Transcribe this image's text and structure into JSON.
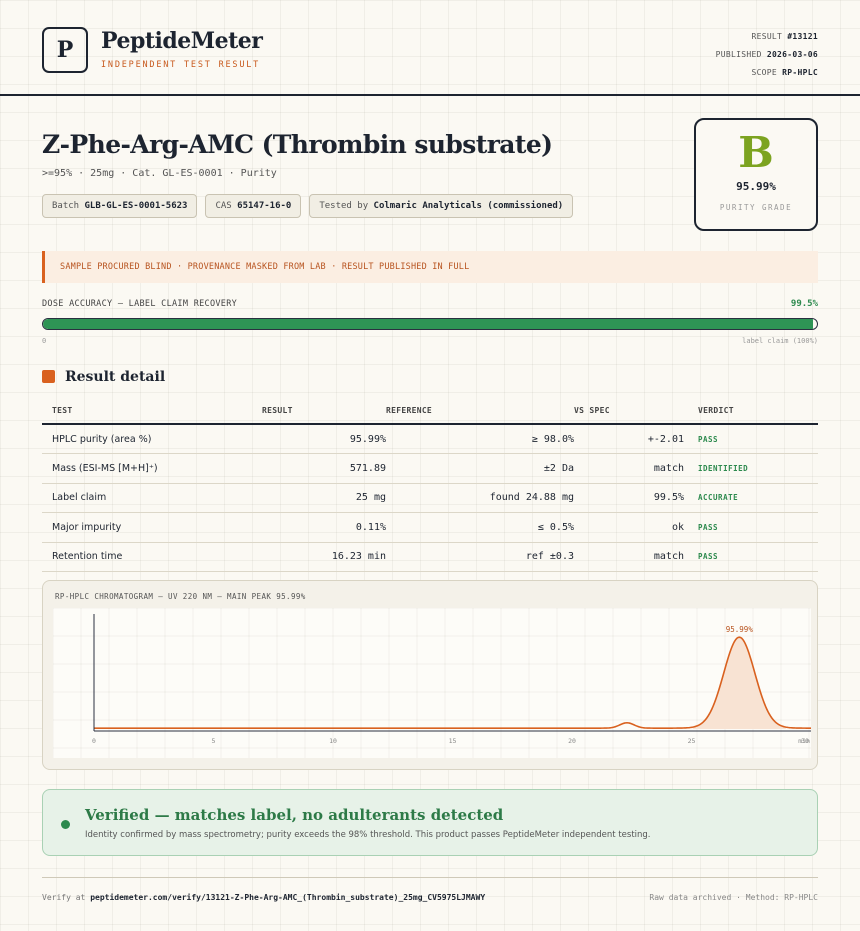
{
  "header": {
    "logo_letter": "P",
    "brand": "PeptideMeter",
    "brand_sub": "INDEPENDENT TEST RESULT",
    "result_label": "RESULT",
    "result_value": "#13121",
    "published_label": "PUBLISHED",
    "published_value": "2026-03-06",
    "scope_label": "SCOPE",
    "scope_value": "RP-HPLC"
  },
  "product": {
    "title": "Z-Phe-Arg-AMC (Thrombin substrate)",
    "subtitle": ">=95% · 25mg · Cat. GL-ES-0001 · Purity",
    "batch_label": "Batch",
    "batch_value": "GLB-GL-ES-0001-5623",
    "cas_label": "CAS",
    "cas_value": "65147-16-0",
    "tested_label": "Tested by",
    "tested_value": "Colmaric Analyticals (commissioned)"
  },
  "grade": {
    "letter": "B",
    "value": "95.99%",
    "label": "PURITY GRADE",
    "color": "#7ca320"
  },
  "notice": "SAMPLE PROCURED BLIND · PROVENANCE MASKED FROM LAB · RESULT PUBLISHED IN FULL",
  "dose": {
    "label": "DOSE ACCURACY — LABEL CLAIM RECOVERY",
    "value_text": "99.5%",
    "fraction": 0.995,
    "min_label": "0",
    "max_label": "label claim (100%)"
  },
  "section_title": "Result detail",
  "table": {
    "headers": [
      "TEST",
      "RESULT",
      "REFERENCE",
      "VS SPEC",
      "VERDICT"
    ],
    "rows": [
      {
        "test": "HPLC purity (area %)",
        "result": "95.99%",
        "reference": "≥ 98.0%",
        "vs_spec": "+-2.01",
        "verdict": "PASS"
      },
      {
        "test": "Mass (ESI-MS [M+H]⁺)",
        "result": "571.89",
        "reference": "±2 Da",
        "vs_spec": "match",
        "verdict": "IDENTIFIED"
      },
      {
        "test": "Label claim",
        "result": "25 mg",
        "reference": "found 24.88 mg",
        "vs_spec": "99.5%",
        "verdict": "ACCURATE"
      },
      {
        "test": "Major impurity",
        "result": "0.11%",
        "reference": "≤ 0.5%",
        "vs_spec": "ok",
        "verdict": "PASS"
      },
      {
        "test": "Retention time",
        "result": "16.23 min",
        "reference": "ref ±0.3",
        "vs_spec": "match",
        "verdict": "PASS"
      }
    ]
  },
  "chart_data": {
    "type": "line",
    "title": "RP-HPLC CHROMATOGRAM — UV 220 NM — MAIN PEAK 95.99%",
    "xlabel": "min",
    "x_ticks": [
      "0",
      "5",
      "10",
      "15",
      "20",
      "25",
      "30"
    ],
    "xlim": [
      0,
      30
    ],
    "peaks": [
      {
        "x": 22.3,
        "height": 0.05,
        "width": 0.3
      },
      {
        "x": 27.0,
        "height": 0.85,
        "width": 0.65,
        "label": "95.99%"
      }
    ],
    "baseline": 0.008,
    "line_color": "#d9611f",
    "fill_color": "#f8e3d3"
  },
  "verified": {
    "title": "Verified — matches label, no adulterants detected",
    "subtitle": "Identity confirmed by mass spectrometry; purity exceeds the 98% threshold. This product passes PeptideMeter independent testing.",
    "color": "#2d8a4e"
  },
  "footer": {
    "verify_prefix": "Verify at",
    "verify_url": "peptidemeter.com/verify/13121-Z-Phe-Arg-AMC_(Thrombin_substrate)_25mg_CV5975LJMAWY",
    "right": "Raw data archived · Method: RP-HPLC"
  }
}
